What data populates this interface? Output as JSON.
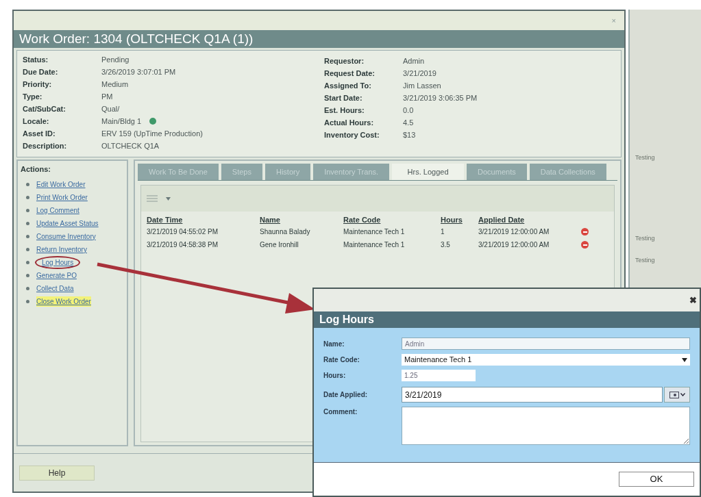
{
  "window": {
    "title": "Work Order: 1304 (OLTCHECK Q1A (1))",
    "close": "×"
  },
  "details_left": [
    {
      "label": "Status:",
      "value": "Pending"
    },
    {
      "label": "Due Date:",
      "value": "3/26/2019 3:07:01 PM"
    },
    {
      "label": "Priority:",
      "value": "Medium"
    },
    {
      "label": "Type:",
      "value": "PM"
    },
    {
      "label": "Cat/SubCat:",
      "value": "Qual/"
    },
    {
      "label": "Locale:",
      "value": "Main/Bldg 1",
      "color": "#3f9a6a"
    },
    {
      "label": "Asset ID:",
      "value": "ERV 159 (UpTime Production)"
    },
    {
      "label": "Description:",
      "value": "OLTCHECK Q1A"
    }
  ],
  "details_right": [
    {
      "label": "Requestor:",
      "value": "Admin"
    },
    {
      "label": "Request Date:",
      "value": "3/21/2019"
    },
    {
      "label": "Assigned To:",
      "value": "Jim Lassen"
    },
    {
      "label": "Start Date:",
      "value": "3/21/2019 3:06:35 PM"
    },
    {
      "label": "Est. Hours:",
      "value": "0.0"
    },
    {
      "label": "Actual Hours:",
      "value": "4.5"
    },
    {
      "label": "Inventory Cost:",
      "value": "$13"
    }
  ],
  "actions": {
    "title": "Actions:",
    "items": [
      {
        "label": "Edit Work Order",
        "highlighted": false,
        "circled": false
      },
      {
        "label": "Print Work Order",
        "highlighted": false,
        "circled": false
      },
      {
        "label": "Log Comment",
        "highlighted": false,
        "circled": false
      },
      {
        "label": "Update Asset Status",
        "highlighted": false,
        "circled": false
      },
      {
        "label": "Consume Inventory",
        "highlighted": false,
        "circled": false
      },
      {
        "label": "Return Inventory",
        "highlighted": false,
        "circled": false
      },
      {
        "label": "Log Hours",
        "highlighted": false,
        "circled": true
      },
      {
        "label": "Generate PO",
        "highlighted": false,
        "circled": false
      },
      {
        "label": "Collect Data",
        "highlighted": false,
        "circled": false
      },
      {
        "label": "Close Work Order",
        "highlighted": true,
        "circled": false
      }
    ]
  },
  "tabs": [
    {
      "label": "Work To Be Done",
      "selected": false
    },
    {
      "label": "Steps",
      "selected": false
    },
    {
      "label": "History",
      "selected": false
    },
    {
      "label": "Inventory Trans.",
      "selected": false
    },
    {
      "label": "Hrs. Logged",
      "selected": true
    },
    {
      "label": "Documents",
      "selected": false
    },
    {
      "label": "Data Collections",
      "selected": false
    }
  ],
  "table": {
    "columns": [
      "Date Time",
      "Name",
      "Rate Code",
      "Hours",
      "Applied Date"
    ],
    "rows": [
      {
        "cells": [
          "3/21/2019 04:55:02 PM",
          "Shaunna Balady",
          "Maintenance Tech 1",
          "1",
          "3/21/2019 12:00:00 AM"
        ]
      },
      {
        "cells": [
          "3/21/2019 04:58:38 PM",
          "Gene Ironhill",
          "Maintenance Tech 1",
          "3.5",
          "3/21/2019 12:00:00 AM"
        ]
      }
    ]
  },
  "footer": {
    "help_button": "Help"
  },
  "background_window": {
    "rows": [
      "Testing",
      "Testing",
      "Testing"
    ]
  },
  "dialog": {
    "close": "✖",
    "title": "Log Hours",
    "name_label": "Name:",
    "name_value": "Admin",
    "rate_label": "Rate Code:",
    "rate_value": "Maintenance Tech 1",
    "hours_label": "Hours:",
    "hours_value": "1.25",
    "date_label": "Date Applied:",
    "date_value": "3/21/2019",
    "comment_label": "Comment:",
    "ok_button": "OK"
  }
}
